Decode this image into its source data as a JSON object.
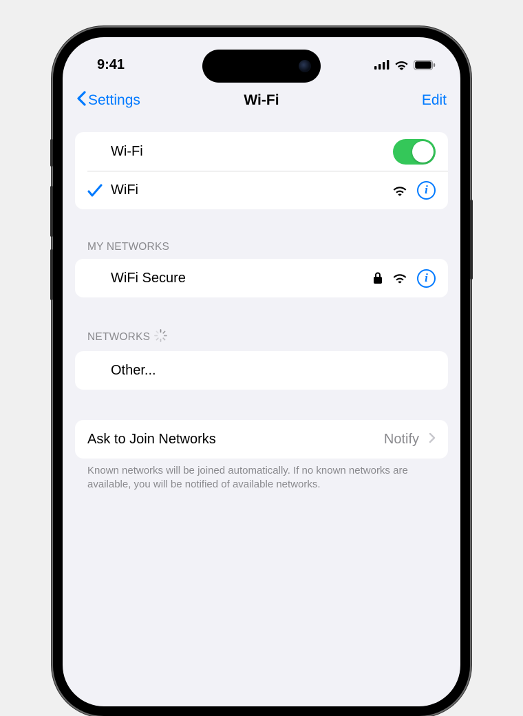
{
  "status": {
    "time": "9:41"
  },
  "nav": {
    "back_label": "Settings",
    "title": "Wi-Fi",
    "edit_label": "Edit"
  },
  "wifi_main": {
    "toggle_label": "Wi-Fi",
    "enabled": true,
    "connected_network": "WiFi"
  },
  "sections": {
    "my_networks_header": "MY NETWORKS",
    "my_networks": [
      {
        "name": "WiFi Secure",
        "locked": true
      }
    ],
    "networks_header": "NETWORKS",
    "other_label": "Other..."
  },
  "ask": {
    "label": "Ask to Join Networks",
    "value": "Notify",
    "footer": "Known networks will be joined automatically. If no known networks are available, you will be notified of available networks."
  },
  "colors": {
    "tint": "#007aff",
    "toggle_on": "#34c759"
  }
}
